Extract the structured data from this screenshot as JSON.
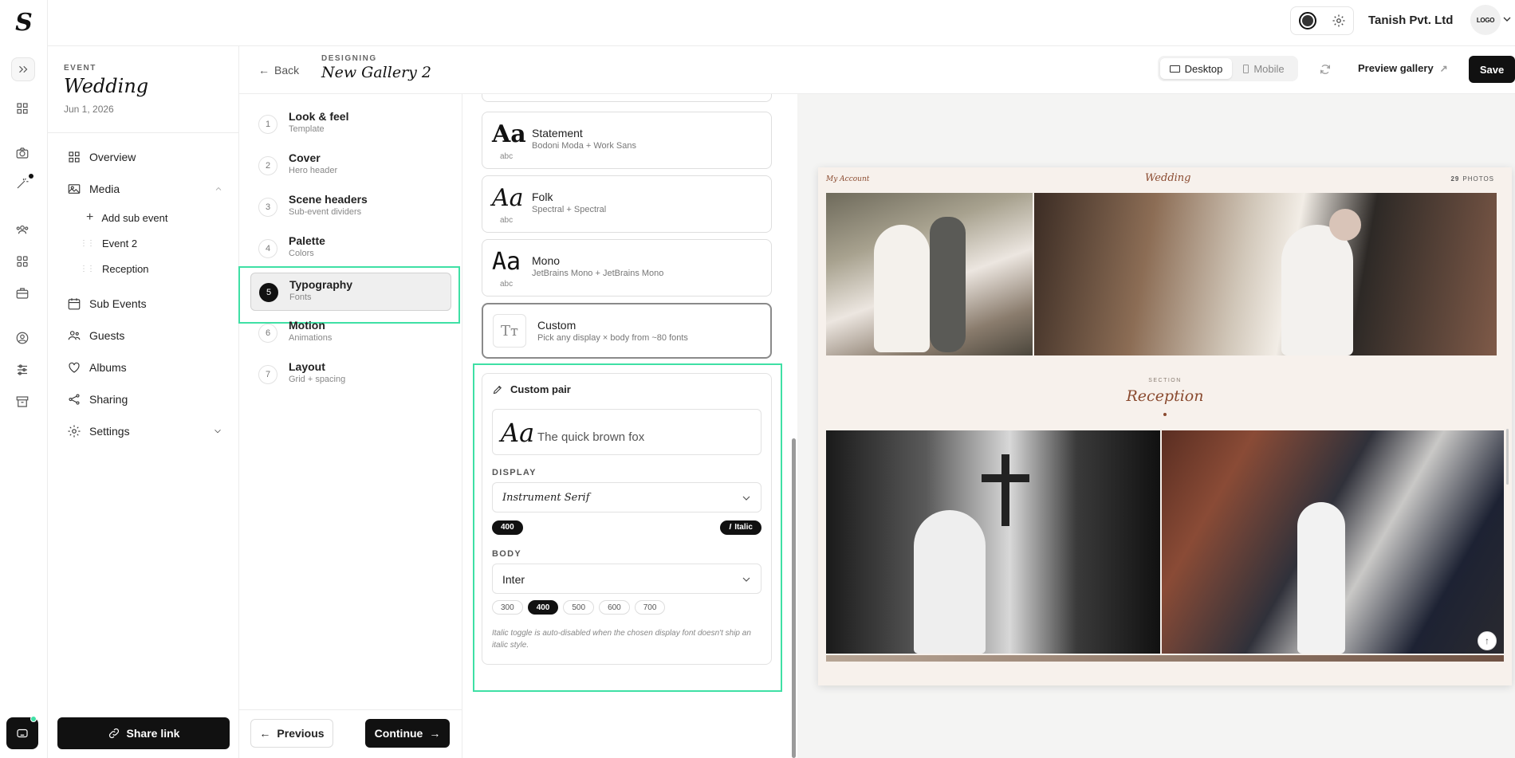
{
  "brand": {
    "logo_letter": "S"
  },
  "header": {
    "org_name": "Tanish Pvt. Ltd",
    "org_logo_text": "LOGO"
  },
  "event": {
    "kicker": "EVENT",
    "title": "Wedding",
    "date": "Jun 1, 2026"
  },
  "designer": {
    "back_label": "Back",
    "kicker": "DESIGNING",
    "gallery_name": "New Gallery 2"
  },
  "toolbar": {
    "desktop_label": "Desktop",
    "mobile_label": "Mobile",
    "preview_label": "Preview gallery",
    "save_label": "Save"
  },
  "nav": {
    "overview": "Overview",
    "media": "Media",
    "add_sub_event": "Add sub event",
    "media_children": [
      "Event 2",
      "Reception"
    ],
    "sub_events": "Sub Events",
    "guests": "Guests",
    "albums": "Albums",
    "sharing": "Sharing",
    "settings": "Settings",
    "share_link": "Share link"
  },
  "steps": [
    {
      "num": "1",
      "title": "Look & feel",
      "sub": "Template"
    },
    {
      "num": "2",
      "title": "Cover",
      "sub": "Hero header"
    },
    {
      "num": "3",
      "title": "Scene headers",
      "sub": "Sub-event dividers"
    },
    {
      "num": "4",
      "title": "Palette",
      "sub": "Colors"
    },
    {
      "num": "5",
      "title": "Typography",
      "sub": "Fonts"
    },
    {
      "num": "6",
      "title": "Motion",
      "sub": "Animations"
    },
    {
      "num": "7",
      "title": "Layout",
      "sub": "Grid + spacing"
    }
  ],
  "footer": {
    "previous": "Previous",
    "continue": "Continue"
  },
  "font_options": [
    {
      "aa": "Aa",
      "abc": "abc",
      "name": "Statement",
      "desc": "Bodoni Moda + Work Sans"
    },
    {
      "aa": "Aa",
      "abc": "abc",
      "name": "Folk",
      "desc": "Spectral + Spectral"
    },
    {
      "aa": "Aa",
      "abc": "abc",
      "name": "Mono",
      "desc": "JetBrains Mono + JetBrains Mono"
    },
    {
      "aa": "Tт",
      "name": "Custom",
      "desc": "Pick any display × body from ~80 fonts"
    }
  ],
  "custom_pair": {
    "title": "Custom pair",
    "sample_aa": "Aa",
    "sample_text": "The quick brown fox",
    "display_label": "DISPLAY",
    "display_font": "Instrument Serif",
    "display_weight": "400",
    "italic_label": "Italic",
    "body_label": "BODY",
    "body_font": "Inter",
    "body_weights": [
      "300",
      "400",
      "500",
      "600",
      "700"
    ],
    "body_weight_selected": "400",
    "note": "Italic toggle is auto-disabled when the chosen display font doesn't ship an italic style."
  },
  "gallery_preview": {
    "account": "My Account",
    "title": "Wedding",
    "photo_count": "29",
    "photos_label": "PHOTOS",
    "section_kicker": "SECTION",
    "section_title": "Reception"
  },
  "colors": {
    "accent_highlight": "#3fe0a5",
    "dark": "#111111",
    "preview_accent": "#8a4a2f"
  }
}
